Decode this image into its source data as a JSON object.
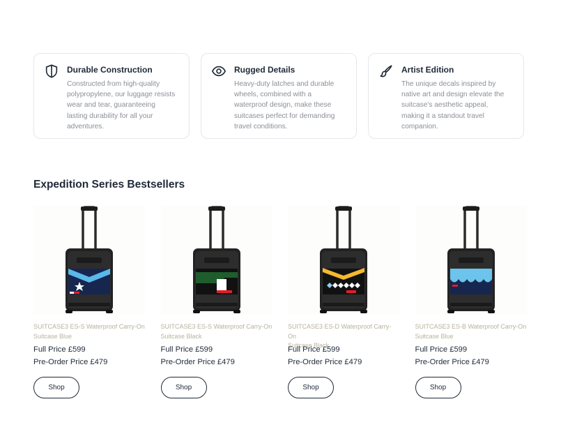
{
  "features": [
    {
      "icon": "shield-icon",
      "title": "Durable Construction",
      "lines": [
        "Constructed from high-quality",
        "polypropylene, our luggage resists",
        "wear and tear, guaranteeing",
        "lasting durability for all your",
        "adventures."
      ]
    },
    {
      "icon": "eye-icon",
      "title": "Rugged Details",
      "lines": [
        "Heavy-duty latches and durable",
        "wheels, combined with a",
        "waterproof design, make these",
        "suitcases perfect for demanding",
        "travel conditions."
      ]
    },
    {
      "icon": "paintbrush-icon",
      "title": "Artist Edition",
      "lines": [
        "The unique decals inspired by",
        "native art and design elevate the",
        "suitcase's aesthetic appeal,",
        "making it a standout travel",
        "companion."
      ]
    }
  ],
  "section_title": "Expedition Series Bestsellers",
  "products": [
    {
      "name_lines": [
        "SUITCASE3 ES-S Waterproof Carry-On",
        "Suitcase Blue"
      ],
      "full_price": "Full Price £599",
      "preorder_price": "Pre-Order Price £479",
      "shop_label": "Shop",
      "decal": "star-flag-blue"
    },
    {
      "name_lines": [
        "SUITCASE3 ES-S Waterproof Carry-On",
        "Suitcase Black"
      ],
      "full_price": "Full Price £599",
      "preorder_price": "Pre-Order Price £479",
      "shop_label": "Shop",
      "decal": "green-black-white"
    },
    {
      "name_lines": [
        "SUITCASE3 ES-D Waterproof Carry-On",
        "Suitcase Black"
      ],
      "full_price": "Full Price £599",
      "preorder_price": "Pre-Order Price £479",
      "shop_label": "Shop",
      "decal": "yellow-diamonds"
    },
    {
      "name_lines": [
        "SUITCASE3 ES-B Waterproof Carry-On",
        "Suitcase Blue"
      ],
      "full_price": "Full Price £599",
      "preorder_price": "Pre-Order Price £479",
      "shop_label": "Shop",
      "decal": "lightblue-waves"
    }
  ],
  "colors": {
    "text": "#1f2937",
    "muted": "#8b8f96",
    "product_name": "#b6b29c",
    "border": "#e5e7eb"
  }
}
